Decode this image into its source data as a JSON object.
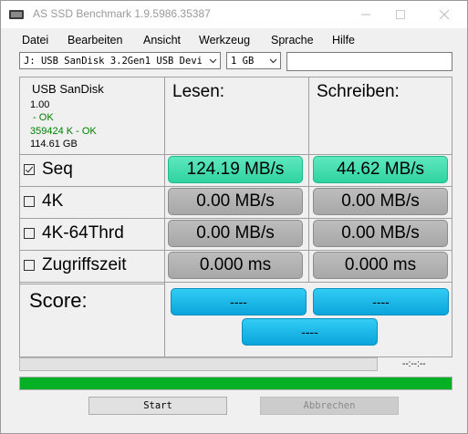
{
  "window": {
    "title": "AS SSD Benchmark 1.9.5986.35387"
  },
  "menu": [
    "Datei",
    "Bearbeiten",
    "Ansicht",
    "Werkzeug",
    "Sprache",
    "Hilfe"
  ],
  "drive_select": {
    "value": "J:  USB  SanDisk 3.2Gen1 USB Devi"
  },
  "size_select": {
    "value": "1 GB"
  },
  "drive_info": {
    "name": "USB  SanDisk",
    "version": "1.00",
    "driver_status": " - OK",
    "alignment": "359424 K - OK",
    "capacity": "114.61 GB"
  },
  "columns": {
    "read": "Lesen:",
    "write": "Schreiben:"
  },
  "tests": [
    {
      "label": "Seq",
      "checked": true,
      "read": "124.19 MB/s",
      "write": "44.62 MB/s",
      "status": "done"
    },
    {
      "label": "4K",
      "checked": false,
      "read": "0.00 MB/s",
      "write": "0.00 MB/s",
      "status": "idle"
    },
    {
      "label": "4K-64Thrd",
      "checked": false,
      "read": "0.00 MB/s",
      "write": "0.00 MB/s",
      "status": "idle"
    },
    {
      "label": "Zugriffszeit",
      "checked": false,
      "read": "0.000 ms",
      "write": "0.000 ms",
      "status": "idle"
    }
  ],
  "score": {
    "label": "Score:",
    "read": "----",
    "write": "----",
    "total": "----"
  },
  "progress": {
    "elapsed": "--:--:--",
    "sub_fraction": 0.0,
    "overall_fraction": 1.0
  },
  "buttons": {
    "start": "Start",
    "abort": "Abbrechen"
  },
  "colors": {
    "done_accent": "#2ed39f",
    "score_accent": "#0aa5dc",
    "progress_green": "#06b025"
  }
}
